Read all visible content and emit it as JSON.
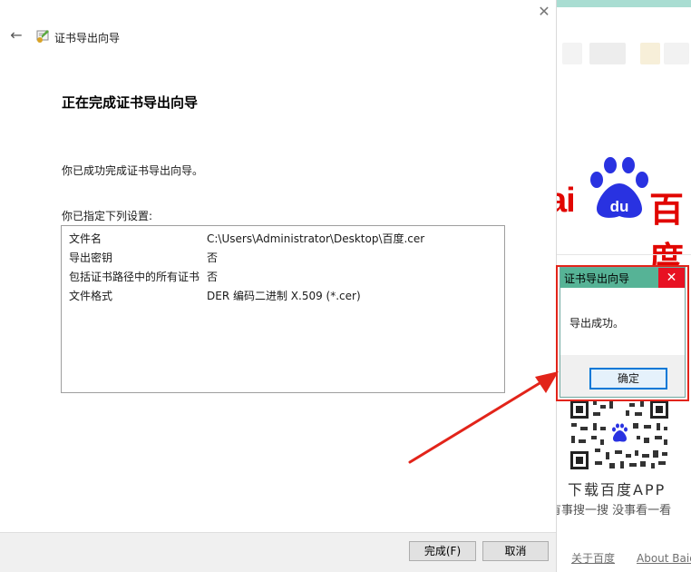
{
  "wizard": {
    "title": "证书导出向导",
    "heading": "正在完成证书导出向导",
    "success_text": "你已成功完成证书导出向导。",
    "settings_label": "你已指定下列设置:",
    "settings": [
      {
        "key": "文件名",
        "value": "C:\\Users\\Administrator\\Desktop\\百度.cer"
      },
      {
        "key": "导出密钥",
        "value": "否"
      },
      {
        "key": "包括证书路径中的所有证书",
        "value": "否"
      },
      {
        "key": "文件格式",
        "value": "DER 编码二进制 X.509 (*.cer)"
      }
    ],
    "finish_label": "完成(F)",
    "cancel_label": "取消"
  },
  "dialog": {
    "title": "证书导出向导",
    "message": "导出成功。",
    "ok_label": "确定",
    "highlight_color": "#e2241a"
  },
  "browser": {
    "logo_ai": "ai",
    "logo_du": "du",
    "logo_bai": "百度",
    "download_app": "下载百度APP",
    "slogan": "有事搜一搜  没事看一看",
    "footer_links": [
      "关于百度",
      "About Baidu"
    ],
    "brand_color": "#e10601",
    "paw_color": "#2932e1"
  }
}
